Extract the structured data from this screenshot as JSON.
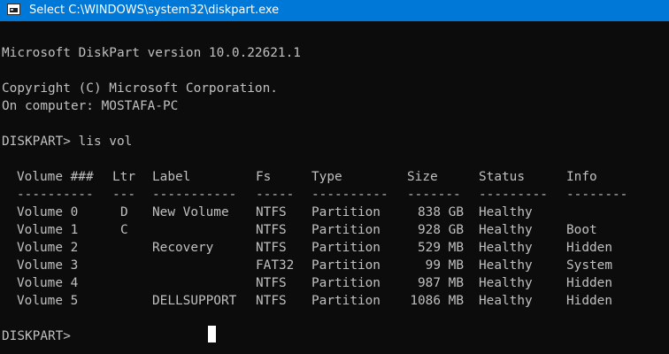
{
  "window": {
    "title": "Select C:\\WINDOWS\\system32\\diskpart.exe"
  },
  "console": {
    "version_line": "Microsoft DiskPart version 10.0.22621.1",
    "copyright_line": "Copyright (C) Microsoft Corporation.",
    "computer_line": "On computer: MOSTAFA-PC",
    "command_line": "DISKPART> lis vol",
    "table": {
      "headers": [
        "Volume ###",
        "Ltr",
        "Label",
        "Fs",
        "Type",
        "Size",
        "Status",
        "Info"
      ],
      "separators": [
        "----------",
        "---",
        "-----------",
        "-----",
        "----------",
        "-------",
        "---------",
        "--------"
      ],
      "rows": [
        {
          "volume": "Volume 0",
          "ltr": "D",
          "label": "New Volume",
          "fs": "NTFS",
          "type": "Partition",
          "size": "838 GB",
          "status": "Healthy",
          "info": ""
        },
        {
          "volume": "Volume 1",
          "ltr": "C",
          "label": "",
          "fs": "NTFS",
          "type": "Partition",
          "size": "928 GB",
          "status": "Healthy",
          "info": "Boot"
        },
        {
          "volume": "Volume 2",
          "ltr": "",
          "label": "Recovery",
          "fs": "NTFS",
          "type": "Partition",
          "size": "529 MB",
          "status": "Healthy",
          "info": "Hidden"
        },
        {
          "volume": "Volume 3",
          "ltr": "",
          "label": "",
          "fs": "FAT32",
          "type": "Partition",
          "size": "99 MB",
          "status": "Healthy",
          "info": "System"
        },
        {
          "volume": "Volume 4",
          "ltr": "",
          "label": "",
          "fs": "NTFS",
          "type": "Partition",
          "size": "987 MB",
          "status": "Healthy",
          "info": "Hidden"
        },
        {
          "volume": "Volume 5",
          "ltr": "",
          "label": "DELLSUPPORT",
          "fs": "NTFS",
          "type": "Partition",
          "size": "1086 MB",
          "status": "Healthy",
          "info": "Hidden"
        }
      ]
    },
    "prompt_line": "DISKPART>"
  }
}
